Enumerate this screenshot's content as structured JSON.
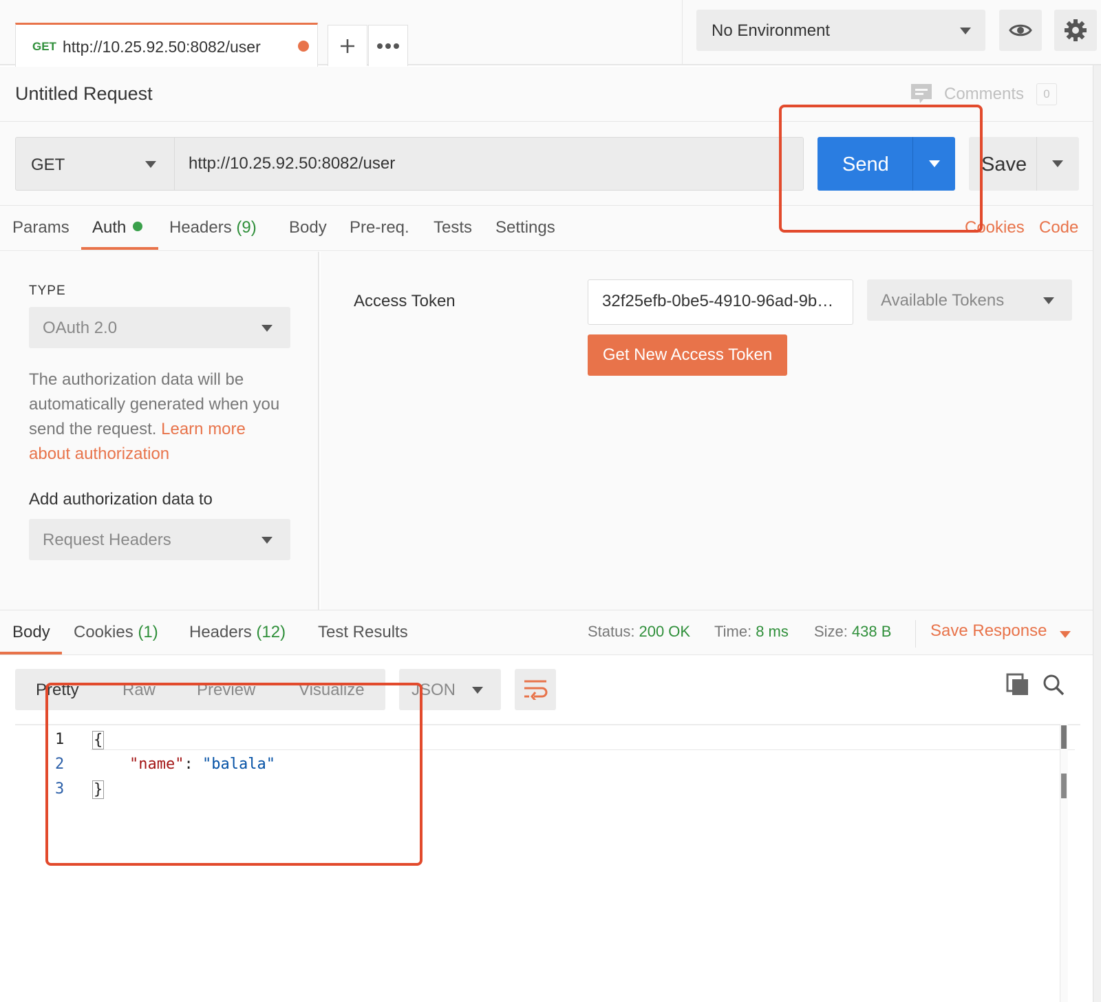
{
  "tab": {
    "method": "GET",
    "url": "http://10.25.92.50:8082/user"
  },
  "environment": {
    "selected": "No Environment"
  },
  "request": {
    "title": "Untitled Request",
    "comments_label": "Comments",
    "comments_count": "0",
    "method": "GET",
    "url": "http://10.25.92.50:8082/user",
    "send_label": "Send",
    "save_label": "Save"
  },
  "request_tabs": {
    "params": "Params",
    "auth": "Auth",
    "headers": "Headers",
    "headers_count": "(9)",
    "body": "Body",
    "prereq": "Pre-req.",
    "tests": "Tests",
    "settings": "Settings",
    "cookies": "Cookies",
    "code": "Code"
  },
  "auth": {
    "type_label": "TYPE",
    "type_value": "OAuth 2.0",
    "description": "The authorization data will be automatically generated when you send the request.",
    "learn_more": "Learn more about authorization",
    "add_to_label": "Add authorization data to",
    "add_to_value": "Request Headers",
    "access_token_label": "Access Token",
    "access_token_value": "32f25efb-0be5-4910-96ad-9b…",
    "available_tokens": "Available Tokens",
    "get_new_token": "Get New Access Token"
  },
  "response_tabs": {
    "body": "Body",
    "cookies": "Cookies",
    "cookies_count": "(1)",
    "headers": "Headers",
    "headers_count": "(12)",
    "test_results": "Test Results"
  },
  "response_meta": {
    "status_label": "Status:",
    "status_value": "200 OK",
    "time_label": "Time:",
    "time_value": "8 ms",
    "size_label": "Size:",
    "size_value": "438 B",
    "save_response": "Save Response"
  },
  "response_view": {
    "pretty": "Pretty",
    "raw": "Raw",
    "preview": "Preview",
    "visualize": "Visualize",
    "format": "JSON"
  },
  "editor": {
    "line_numbers": [
      "1",
      "2",
      "3"
    ],
    "open_brace": "{",
    "key": "\"name\"",
    "colon": ": ",
    "value": "\"balala\"",
    "close_brace": "}"
  },
  "colors": {
    "accent": "#e8734a",
    "send_blue": "#2a7de1",
    "success_green": "#2f8f3a",
    "annotation_red": "#e24a2c"
  },
  "icons": [
    "plus-icon",
    "more-icon",
    "chevron-down-icon",
    "eye-icon",
    "gear-icon",
    "comment-icon",
    "wrap-lines-icon",
    "copy-icon",
    "search-icon"
  ]
}
